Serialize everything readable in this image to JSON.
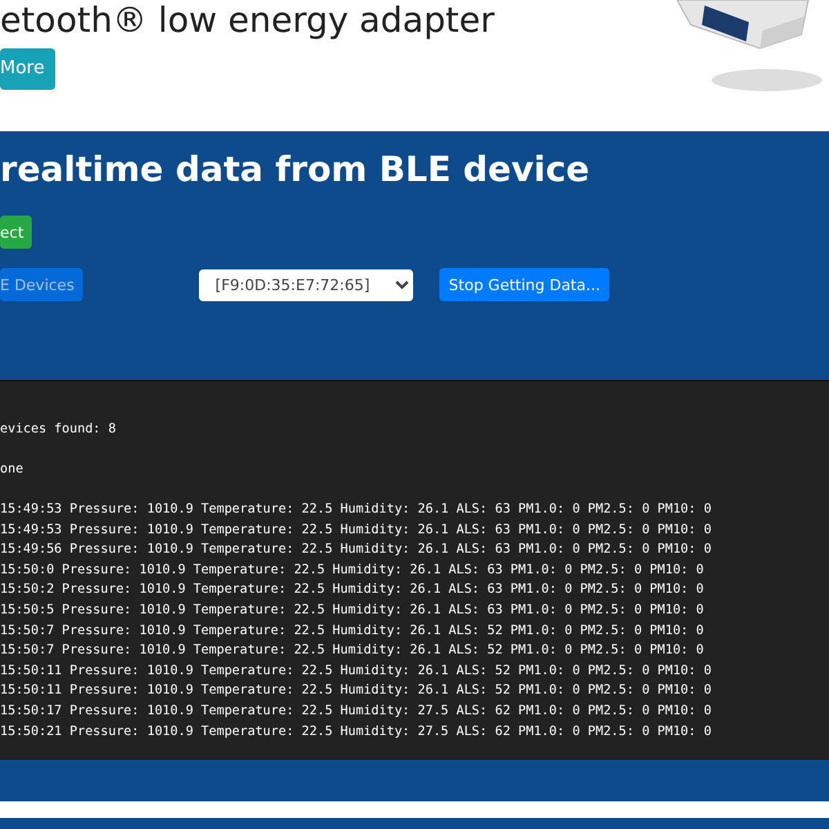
{
  "hero": {
    "heading": "etooth® low energy adapter",
    "button": "More"
  },
  "panel": {
    "title": "realtime data from BLE device",
    "connect_button": "ect",
    "scan_button": {
      "label": "E Devices",
      "disabled": true
    },
    "device_select": {
      "value": "[F9:0D:35:E7:72:65]"
    },
    "stop_button": "Stop Getting Data..."
  },
  "console": {
    "status": [
      "evices found: 8",
      "one"
    ],
    "readings": [
      "15:49:53 Pressure: 1010.9 Temperature: 22.5 Humidity: 26.1 ALS: 63 PM1.0: 0 PM2.5: 0 PM10: 0",
      "15:49:53 Pressure: 1010.9 Temperature: 22.5 Humidity: 26.1 ALS: 63 PM1.0: 0 PM2.5: 0 PM10: 0",
      "15:49:56 Pressure: 1010.9 Temperature: 22.5 Humidity: 26.1 ALS: 63 PM1.0: 0 PM2.5: 0 PM10: 0",
      "15:50:0 Pressure: 1010.9 Temperature: 22.5 Humidity: 26.1 ALS: 63 PM1.0: 0 PM2.5: 0 PM10: 0",
      "15:50:2 Pressure: 1010.9 Temperature: 22.5 Humidity: 26.1 ALS: 63 PM1.0: 0 PM2.5: 0 PM10: 0",
      "15:50:5 Pressure: 1010.9 Temperature: 22.5 Humidity: 26.1 ALS: 63 PM1.0: 0 PM2.5: 0 PM10: 0",
      "15:50:7 Pressure: 1010.9 Temperature: 22.5 Humidity: 26.1 ALS: 52 PM1.0: 0 PM2.5: 0 PM10: 0",
      "15:50:7 Pressure: 1010.9 Temperature: 22.5 Humidity: 26.1 ALS: 52 PM1.0: 0 PM2.5: 0 PM10: 0",
      "15:50:11 Pressure: 1010.9 Temperature: 22.5 Humidity: 26.1 ALS: 52 PM1.0: 0 PM2.5: 0 PM10: 0",
      "15:50:11 Pressure: 1010.9 Temperature: 22.5 Humidity: 26.1 ALS: 52 PM1.0: 0 PM2.5: 0 PM10: 0",
      "15:50:17 Pressure: 1010.9 Temperature: 22.5 Humidity: 27.5 ALS: 62 PM1.0: 0 PM2.5: 0 PM10: 0",
      "15:50:21 Pressure: 1010.9 Temperature: 22.5 Humidity: 27.5 ALS: 62 PM1.0: 0 PM2.5: 0 PM10: 0"
    ]
  }
}
